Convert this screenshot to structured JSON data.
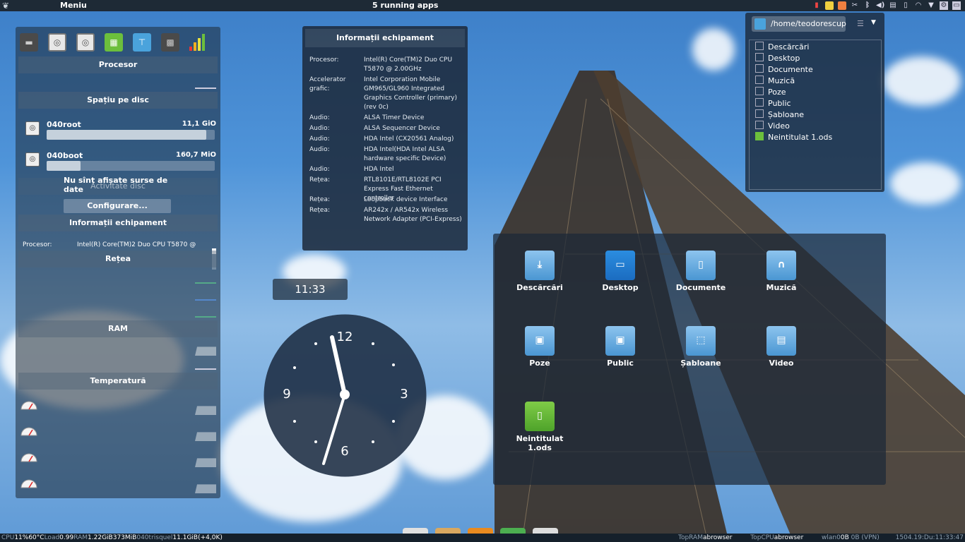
{
  "top_panel": {
    "menu_label": "Meniu",
    "running_apps": "5 running apps"
  },
  "sidebar": {
    "sections": {
      "processor": "Procesor",
      "disk_space": "Spațiu pe disc",
      "disk_activity": "Activitate disc",
      "hardware_info": "Informații echipament",
      "network": "Rețea",
      "ram": "RAM",
      "temperature": "Temperatură"
    },
    "disks": [
      {
        "name": "040root",
        "size": "11,1 GiO",
        "fill": 0.95
      },
      {
        "name": "040boot",
        "size": "160,7 MiO",
        "fill": 0.2
      }
    ],
    "no_data": "Nu sînt afișate surse de date",
    "config_button": "Configurare...",
    "processor_row": {
      "key": "Procesor:",
      "value": "Intel(R) Core(TM)2 Duo CPU T5870 @"
    }
  },
  "info_window": {
    "title": "Informații echipament",
    "rows": [
      {
        "key": "Procesor:",
        "value": "Intel(R) Core(TM)2 Duo CPU T5870 @ 2.00GHz"
      },
      {
        "key": "Accelerator grafic:",
        "value": "Intel Corporation Mobile GM965/GL960 Integrated Graphics Controller (primary) (rev 0c)"
      },
      {
        "key": "Audio:",
        "value": "ALSA Timer Device"
      },
      {
        "key": "Audio:",
        "value": "ALSA Sequencer Device"
      },
      {
        "key": "Audio:",
        "value": "HDA Intel (CX20561 Analog)"
      },
      {
        "key": "Audio:",
        "value": "HDA Intel(HDA Intel ALSA hardware specific Device)"
      },
      {
        "key": "Audio:",
        "value": "HDA Intel"
      },
      {
        "key": "Rețea:",
        "value": "RTL8101E/RTL8102E PCI Express Fast Ethernet controller"
      },
      {
        "key": "Rețea:",
        "value": "Loopback device Interface"
      },
      {
        "key": "Rețea:",
        "value": "AR242x / AR542x Wireless Network Adapter (PCI-Express)"
      }
    ]
  },
  "clock": {
    "digital": "11:33",
    "numerals": {
      "n12": "12",
      "n3": "3",
      "n6": "6",
      "n9": "9"
    }
  },
  "file_window": {
    "path": "/home/teodorescup",
    "items": [
      "Descărcări",
      "Desktop",
      "Documente",
      "Muzică",
      "Poze",
      "Public",
      "Șabloane",
      "Video",
      "Neintitulat 1.ods"
    ]
  },
  "folder_view": {
    "items": [
      {
        "label": "Descărcări",
        "icon": "download-folder-icon"
      },
      {
        "label": "Desktop",
        "icon": "desktop-folder-icon"
      },
      {
        "label": "Documente",
        "icon": "documents-folder-icon"
      },
      {
        "label": "Muzică",
        "icon": "music-folder-icon"
      },
      {
        "label": "Poze",
        "icon": "pictures-folder-icon"
      },
      {
        "label": "Public",
        "icon": "public-folder-icon"
      },
      {
        "label": "Șabloane",
        "icon": "templates-folder-icon"
      },
      {
        "label": "Video",
        "icon": "video-folder-icon"
      },
      {
        "label": "Neintitulat 1.ods",
        "icon": "spreadsheet-file-icon"
      }
    ]
  },
  "bottom_panel": {
    "cpu_label": "CPU",
    "cpu_value": "11%",
    "temp_value": "60°C",
    "load_label": "Load",
    "load_value": "0.99",
    "ram_label": "RAM",
    "ram_value": "1.22GiB",
    "ram2_value": "373MiB",
    "disk_label": "040trisquel",
    "disk_value": "11.1GiB",
    "disk_delta": "(+4,0K)",
    "top_ram_label": "TopRAM",
    "top_ram_value": "abrowser",
    "top_cpu_label": "TopCPU",
    "top_cpu_value": "abrowser",
    "wlan_label": "wlan0",
    "wlan_value": "0B",
    "wlan_up": "0B",
    "vpn": "(VPN)",
    "date_value": "1504.19:Du:11:33:47"
  },
  "colors": {
    "panel": "#1e2a36",
    "accent_green": "#6cbf3c",
    "accent_blue": "#4aa3dc"
  }
}
